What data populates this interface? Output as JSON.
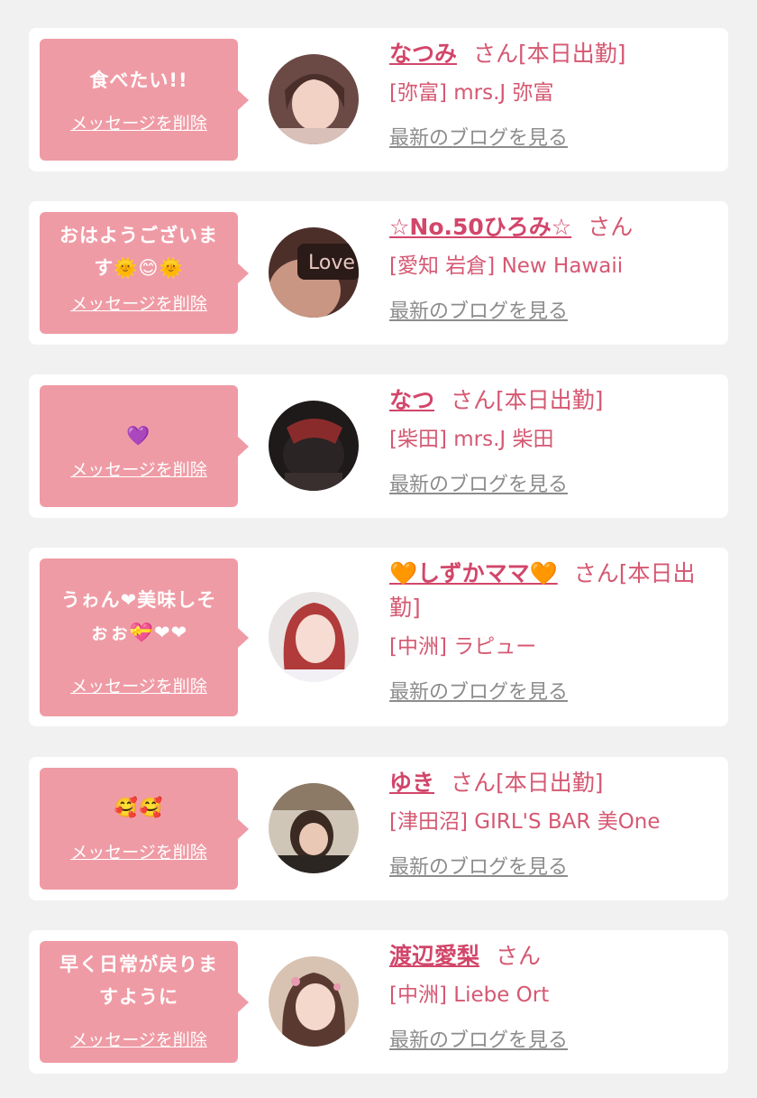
{
  "delete_label": "メッセージを削除",
  "blog_label": "最新のブログを見る",
  "colors": {
    "background": "#f1f1f2",
    "card": "#ffffff",
    "bubble": "#ef9ba5",
    "name": "#d2466a",
    "text": "#d55872",
    "blog_link": "#8c8c8c"
  },
  "entries": [
    {
      "message": "食べたい!!",
      "name": "なつみ",
      "suffix": "さん[本日出勤]",
      "shop": "[弥富] mrs.J 弥富"
    },
    {
      "message": "おはようございま\nす🌞😊🌞",
      "name": "☆No.50ひろみ☆",
      "suffix": "さん",
      "shop": "[愛知 岩倉] New Hawaii"
    },
    {
      "message": "💜",
      "name": "なつ",
      "suffix": "さん[本日出勤]",
      "shop": "[柴田] mrs.J 柴田"
    },
    {
      "message": "うゎん❤美味しそ\nぉぉ💝❤❤",
      "name": "🧡しずかママ🧡",
      "suffix": "さん[本日出勤]",
      "shop": "[中洲] ラピュー"
    },
    {
      "message": "🥰🥰",
      "name": "ゆき",
      "suffix": "さん[本日出勤]",
      "shop": "[津田沼] GIRL'S BAR 美One"
    },
    {
      "message": "早く日常が戻りま\nすように",
      "name": "渡辺愛梨",
      "suffix": "さん",
      "shop": "[中洲] Liebe Ort"
    }
  ]
}
